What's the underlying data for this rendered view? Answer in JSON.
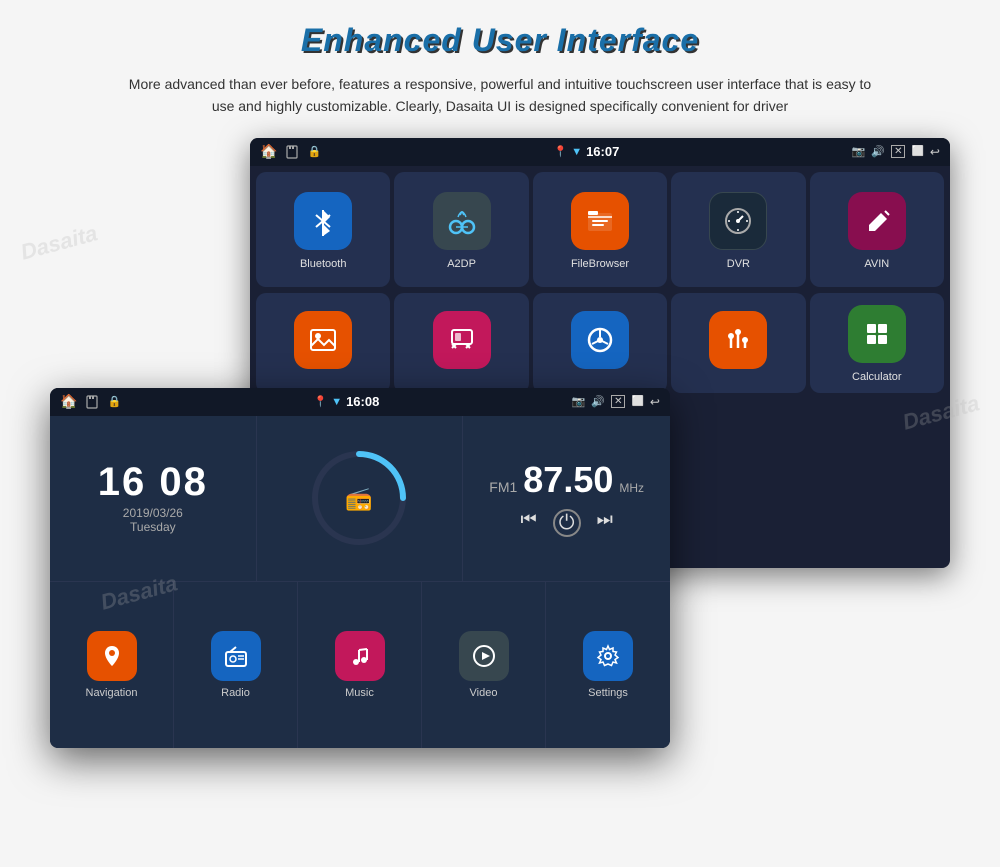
{
  "page": {
    "title": "Enhanced User Interface",
    "description": "More advanced than ever before, features a responsive, powerful and intuitive touchscreen user interface that is easy to use and highly customizable. Clearly, Dasaita UI is designed specifically convenient for driver"
  },
  "back_screen": {
    "status_bar": {
      "time": "16:07",
      "icons": [
        "location",
        "bluetooth",
        "signal"
      ],
      "right_icons": [
        "camera",
        "volume",
        "box",
        "window",
        "back"
      ]
    },
    "apps_row1": [
      {
        "label": "Bluetooth",
        "icon": "bluetooth",
        "color": "#1565c0"
      },
      {
        "label": "A2DP",
        "icon": "headphones",
        "color": "#37474f"
      },
      {
        "label": "FileBrowser",
        "icon": "folder",
        "color": "#e65100"
      },
      {
        "label": "DVR",
        "icon": "speedometer",
        "color": "#1a2a3a"
      },
      {
        "label": "AVIN",
        "icon": "pen",
        "color": "#880e4f"
      }
    ],
    "apps_row2": [
      {
        "label": "",
        "icon": "image",
        "color": "#e65100"
      },
      {
        "label": "",
        "icon": "mirror",
        "color": "#c2185b"
      },
      {
        "label": "",
        "icon": "steering",
        "color": "#1565c0"
      },
      {
        "label": "",
        "icon": "eq",
        "color": "#e65100"
      },
      {
        "label": "Calculator",
        "icon": "calculator",
        "color": "#2e7d32"
      }
    ]
  },
  "front_screen": {
    "status_bar": {
      "time": "16:08",
      "icons": [
        "location",
        "bluetooth",
        "signal"
      ],
      "right_icons": [
        "camera",
        "volume",
        "box",
        "window",
        "back"
      ]
    },
    "clock": {
      "time": "16 08",
      "date": "2019/03/26",
      "day": "Tuesday"
    },
    "radio": {
      "band": "FM1",
      "frequency": "87.50",
      "unit": "MHz"
    },
    "apps": [
      {
        "label": "Navigation",
        "icon": "nav",
        "color": "#e65100"
      },
      {
        "label": "Radio",
        "icon": "radio",
        "color": "#1565c0"
      },
      {
        "label": "Music",
        "icon": "music",
        "color": "#c2185b"
      },
      {
        "label": "Video",
        "icon": "video",
        "color": "#37474f"
      },
      {
        "label": "Settings",
        "icon": "settings",
        "color": "#1565c0"
      }
    ]
  },
  "watermarks": [
    "Dasaita",
    "Dasaita",
    "Dasaita",
    "Dasaita"
  ]
}
